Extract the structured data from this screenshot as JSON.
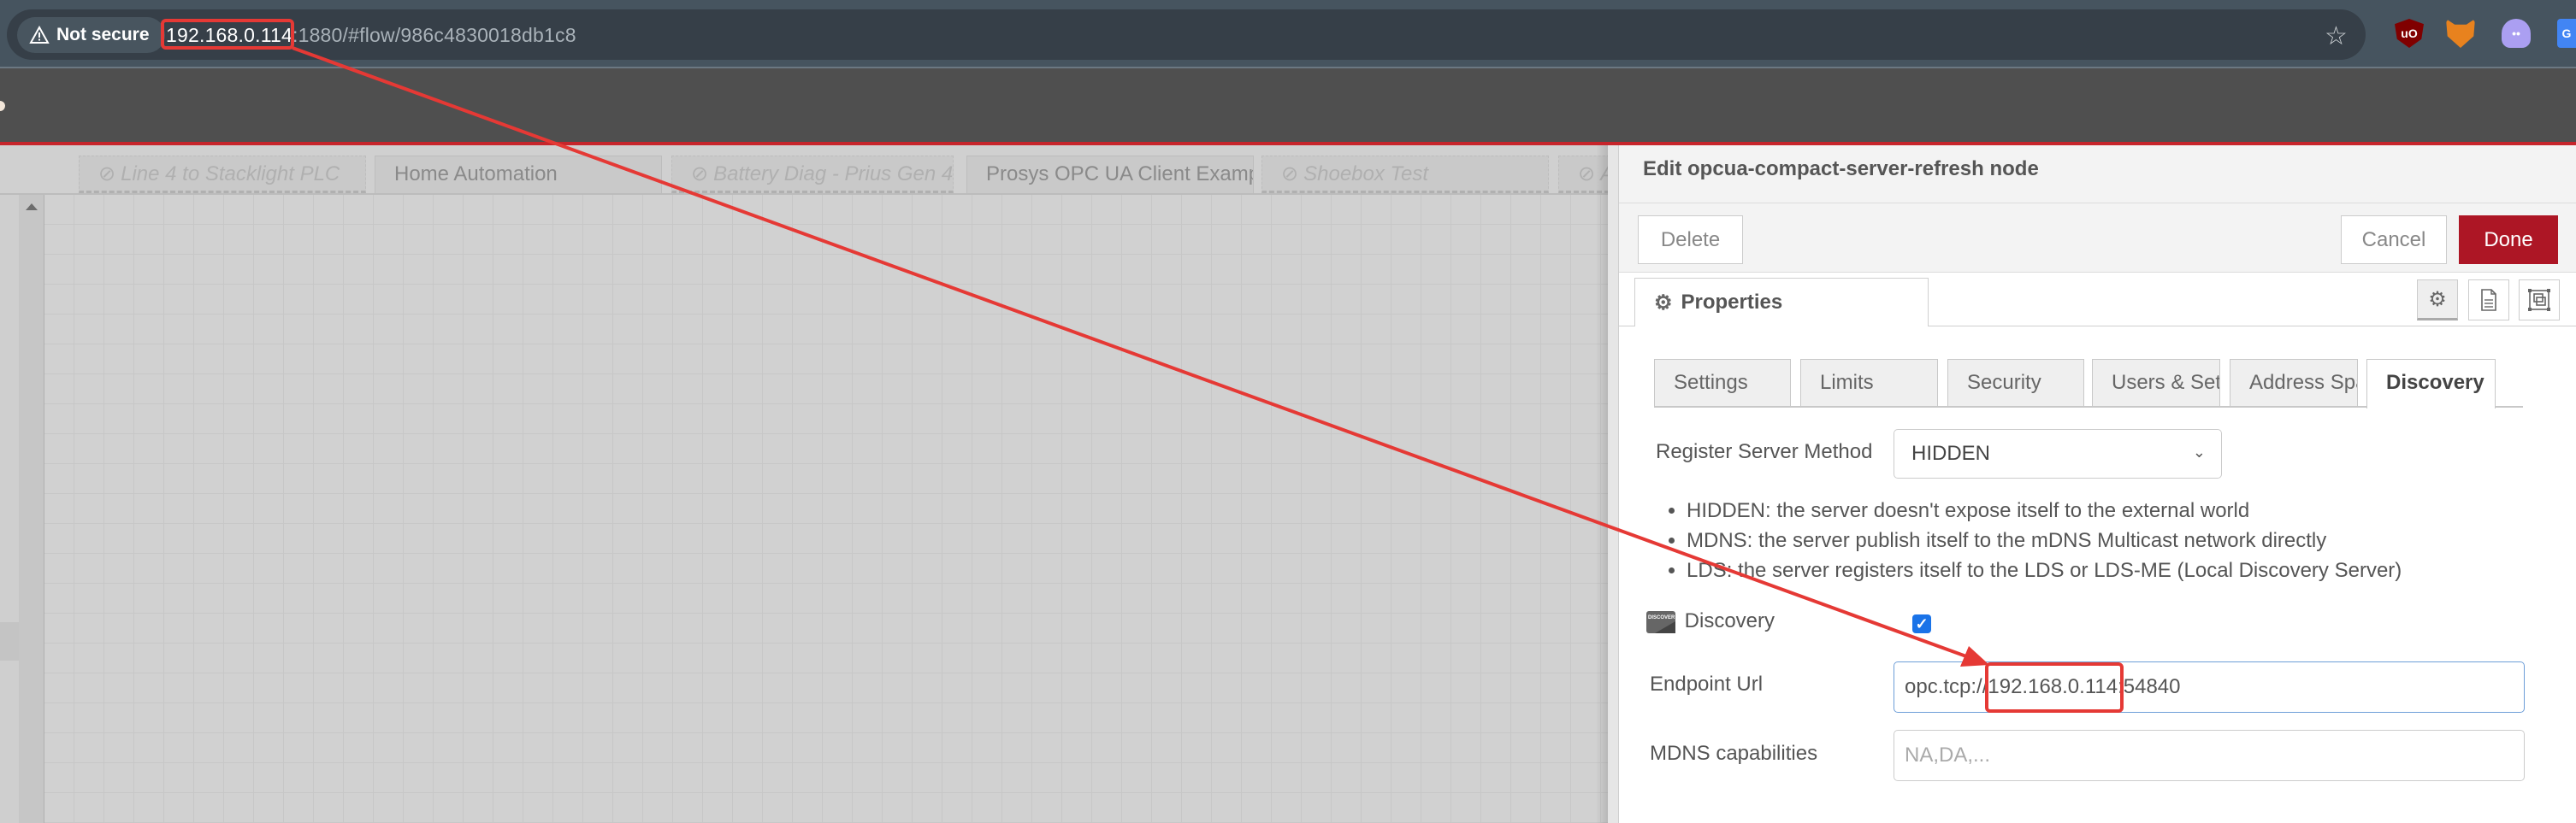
{
  "browser": {
    "security_label": "Not secure",
    "url_host": "192.168.0.114",
    "url_rest": ":1880/#flow/986c4830018db1c8",
    "extensions": [
      "ublock-origin-icon",
      "metamask-icon",
      "phantom-icon",
      "google-translate-icon"
    ]
  },
  "workspace": {
    "tabs": [
      {
        "label": "Line 4 to Stacklight PLC",
        "disabled": true
      },
      {
        "label": "Home Automation",
        "disabled": false
      },
      {
        "label": "Battery Diag - Prius Gen 4",
        "disabled": true
      },
      {
        "label": "Prosys OPC UA Client Example",
        "disabled": false
      },
      {
        "label": "Shoebox Test",
        "disabled": true
      },
      {
        "label": "A",
        "disabled": true
      }
    ]
  },
  "tray": {
    "title": "Edit opcua-compact-server-refresh node",
    "delete_label": "Delete",
    "cancel_label": "Cancel",
    "done_label": "Done",
    "properties_label": "Properties",
    "sub_tabs": [
      "Settings",
      "Limits",
      "Security",
      "Users & Sets",
      "Address Space",
      "Discovery"
    ],
    "active_sub_tab": "Discovery",
    "register_method_label": "Register Server Method",
    "register_method_value": "HIDDEN",
    "help_items": [
      "HIDDEN: the server doesn't expose itself to the external world",
      "MDNS: the server publish itself to the mDNS Multicast network directly",
      "LDS: the server registers itself to the LDS or LDS-ME (Local Discovery Server)"
    ],
    "discovery_label": "Discovery",
    "discovery_checked": true,
    "endpoint_label": "Endpoint Url",
    "endpoint_value": "opc.tcp://192.168.0.114:54840",
    "mdns_label": "MDNS capabilities",
    "mdns_placeholder": "NA,DA,..."
  },
  "colors": {
    "accent_red": "#c6252b",
    "done_button": "#ad1625",
    "annotation": "#e53935"
  }
}
